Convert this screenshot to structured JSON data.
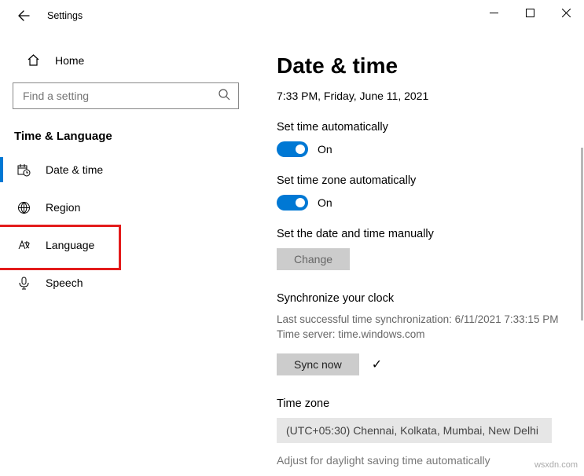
{
  "titlebar": {
    "title": "Settings"
  },
  "sidebar": {
    "home": "Home",
    "search_placeholder": "Find a setting",
    "category": "Time & Language",
    "items": [
      {
        "label": "Date & time"
      },
      {
        "label": "Region"
      },
      {
        "label": "Language"
      },
      {
        "label": "Speech"
      }
    ]
  },
  "main": {
    "heading": "Date & time",
    "current": "7:33 PM, Friday, June 11, 2021",
    "auto_time_label": "Set time automatically",
    "auto_time_state": "On",
    "auto_tz_label": "Set time zone automatically",
    "auto_tz_state": "On",
    "manual_label": "Set the date and time manually",
    "change_btn": "Change",
    "sync_heading": "Synchronize your clock",
    "sync_last": "Last successful time synchronization: 6/11/2021 7:33:15 PM",
    "sync_server": "Time server: time.windows.com",
    "sync_btn": "Sync now",
    "tz_heading": "Time zone",
    "tz_value": "(UTC+05:30) Chennai, Kolkata, Mumbai, New Delhi",
    "adjust_label": "Adjust for daylight saving time automatically"
  },
  "watermark": "wsxdn.com"
}
